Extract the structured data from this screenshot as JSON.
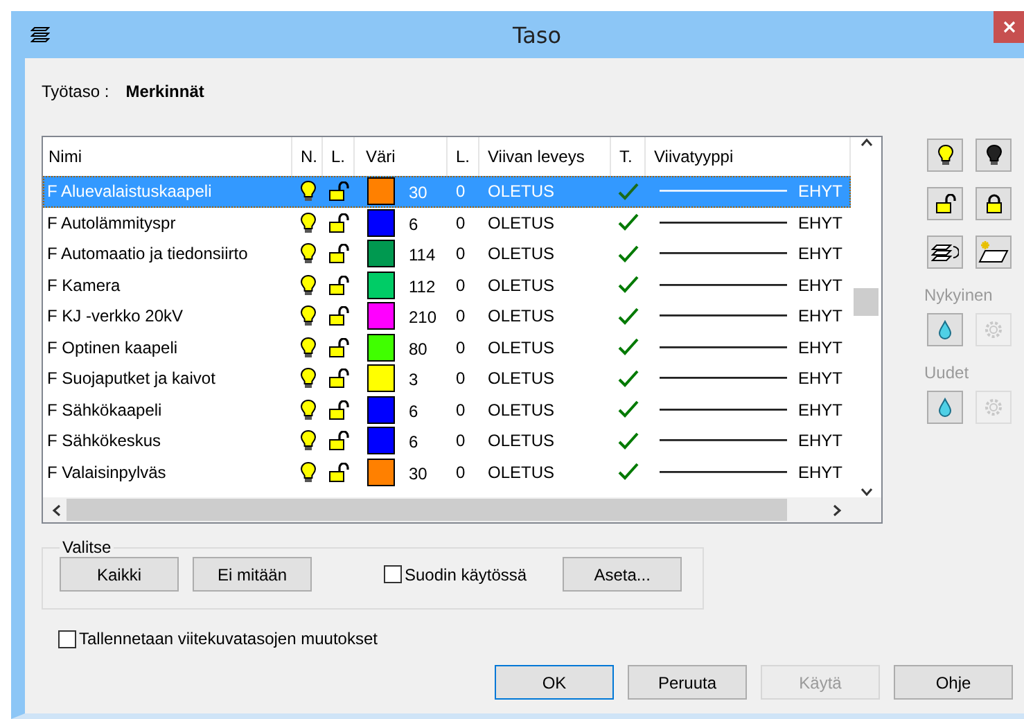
{
  "window": {
    "title": "Taso"
  },
  "work_layer": {
    "label": "Työtaso :",
    "value": "Merkinnät"
  },
  "table": {
    "columns": [
      "Nimi",
      "N.",
      "L.",
      "Väri",
      "L.",
      "Viivan leveys",
      "T.",
      "Viivatyyppi"
    ],
    "rows": [
      {
        "name": "F Aluevalaistuskaapeli",
        "visible": true,
        "locked": false,
        "color": "#ff8000",
        "color_number": "30",
        "column_5": "0",
        "line_width": "OLETUS",
        "plotted": true,
        "line_type": "EHYT",
        "selected": true
      },
      {
        "name": "F Autolämmityspr",
        "visible": true,
        "locked": false,
        "color": "#0000ff",
        "color_number": "6",
        "column_5": "0",
        "line_width": "OLETUS",
        "plotted": true,
        "line_type": "EHYT",
        "selected": false
      },
      {
        "name": "F Automaatio ja tiedonsiirto",
        "visible": true,
        "locked": false,
        "color": "#009950",
        "color_number": "114",
        "column_5": "0",
        "line_width": "OLETUS",
        "plotted": true,
        "line_type": "EHYT",
        "selected": false
      },
      {
        "name": "F Kamera",
        "visible": true,
        "locked": false,
        "color": "#00cc66",
        "color_number": "112",
        "column_5": "0",
        "line_width": "OLETUS",
        "plotted": true,
        "line_type": "EHYT",
        "selected": false
      },
      {
        "name": "F KJ -verkko 20kV",
        "visible": true,
        "locked": false,
        "color": "#ff00ff",
        "color_number": "210",
        "column_5": "0",
        "line_width": "OLETUS",
        "plotted": true,
        "line_type": "EHYT",
        "selected": false
      },
      {
        "name": "F Optinen kaapeli",
        "visible": true,
        "locked": false,
        "color": "#40ff00",
        "color_number": "80",
        "column_5": "0",
        "line_width": "OLETUS",
        "plotted": true,
        "line_type": "EHYT",
        "selected": false
      },
      {
        "name": "F Suojaputket ja kaivot",
        "visible": true,
        "locked": false,
        "color": "#ffff00",
        "color_number": "3",
        "column_5": "0",
        "line_width": "OLETUS",
        "plotted": true,
        "line_type": "EHYT",
        "selected": false
      },
      {
        "name": "F Sähkökaapeli",
        "visible": true,
        "locked": false,
        "color": "#0000ff",
        "color_number": "6",
        "column_5": "0",
        "line_width": "OLETUS",
        "plotted": true,
        "line_type": "EHYT",
        "selected": false
      },
      {
        "name": "F Sähkökeskus",
        "visible": true,
        "locked": false,
        "color": "#0000ff",
        "color_number": "6",
        "column_5": "0",
        "line_width": "OLETUS",
        "plotted": true,
        "line_type": "EHYT",
        "selected": false
      },
      {
        "name": "F Valaisinpylväs",
        "visible": true,
        "locked": false,
        "color": "#ff8000",
        "color_number": "30",
        "column_5": "0",
        "line_width": "OLETUS",
        "plotted": true,
        "line_type": "EHYT",
        "selected": false
      }
    ]
  },
  "side_tools": {
    "buttons": [
      {
        "kind": "lamp_on"
      },
      {
        "kind": "lamp_off"
      },
      {
        "kind": "unlock"
      },
      {
        "kind": "lock"
      },
      {
        "kind": "layers"
      },
      {
        "kind": "new_layer"
      }
    ],
    "sections": [
      {
        "label": "Nykyinen",
        "disabled": true,
        "buttons": [
          {
            "kind": "drop",
            "disabled": false
          },
          {
            "kind": "gear",
            "disabled": true
          }
        ]
      },
      {
        "label": "Uudet",
        "disabled": true,
        "buttons": [
          {
            "kind": "drop",
            "disabled": false
          },
          {
            "kind": "gear",
            "disabled": true
          }
        ]
      }
    ]
  },
  "select_group": {
    "title": "Valitse",
    "buttons": [
      "Kaikki",
      "Ei mitään"
    ],
    "filter": {
      "label": "Suodin käytössä",
      "checked": false
    },
    "set_button": "Aseta..."
  },
  "save_option": {
    "label": "Tallennetaan viitekuvatasojen muutokset",
    "checked": false
  },
  "dialog_buttons": [
    {
      "label": "OK",
      "default": true,
      "disabled": false
    },
    {
      "label": "Peruuta",
      "default": false,
      "disabled": false
    },
    {
      "label": "Käytä",
      "default": false,
      "disabled": true
    },
    {
      "label": "Ohje",
      "default": false,
      "disabled": false
    }
  ]
}
